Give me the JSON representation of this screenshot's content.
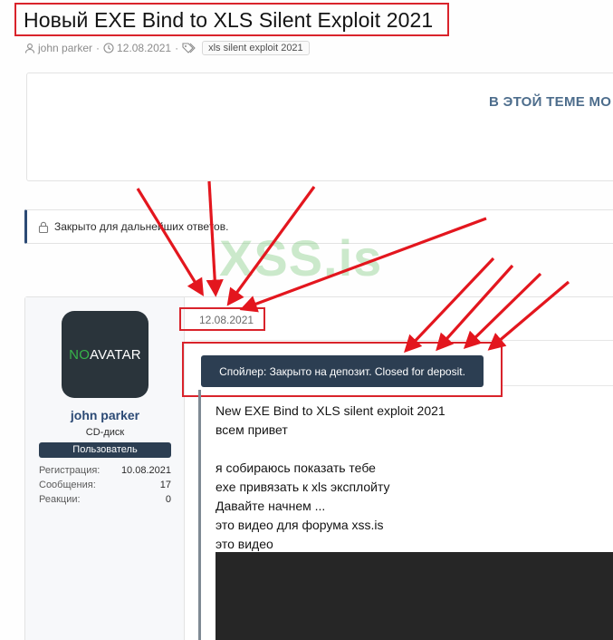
{
  "thread": {
    "title": "Новый EXE Bind to XLS Silent Exploit 2021",
    "author": "john parker",
    "date": "12.08.2021",
    "tag": "xls silent exploit 2021"
  },
  "similar": {
    "title": "В ЭТОЙ ТЕМЕ МО"
  },
  "notice": {
    "locked_text": "Закрыто для дальнейших ответов."
  },
  "watermark": "XSS.is",
  "post": {
    "date": "12.08.2021",
    "spoiler_label": "Спойлер: Закрыто на депозит. Closed for deposit.",
    "content_lines": [
      "New EXE Bind to XLS silent exploit 2021",
      "всем привет",
      "",
      "я собираюсь показать тебе",
      "exe привязать к xls эксплойту",
      "Давайте начнем ...",
      "это видео для форума xss.is",
      "это видео"
    ]
  },
  "user": {
    "avatar_no": "NO",
    "avatar_text": "AVATAR",
    "name": "john parker",
    "title": "CD-диск",
    "role": "Пользователь",
    "stats": [
      {
        "label": "Регистрация:",
        "value": "10.08.2021"
      },
      {
        "label": "Сообщения:",
        "value": "17"
      },
      {
        "label": "Реакции:",
        "value": "0"
      }
    ]
  },
  "colors": {
    "annotation_red": "#d9232b",
    "accent_dark": "#2c3e52",
    "link_blue": "#2c4a75",
    "watermark_green": "#78c878"
  },
  "icons": [
    "user-icon",
    "clock-icon",
    "tag-icon",
    "lock-icon"
  ]
}
